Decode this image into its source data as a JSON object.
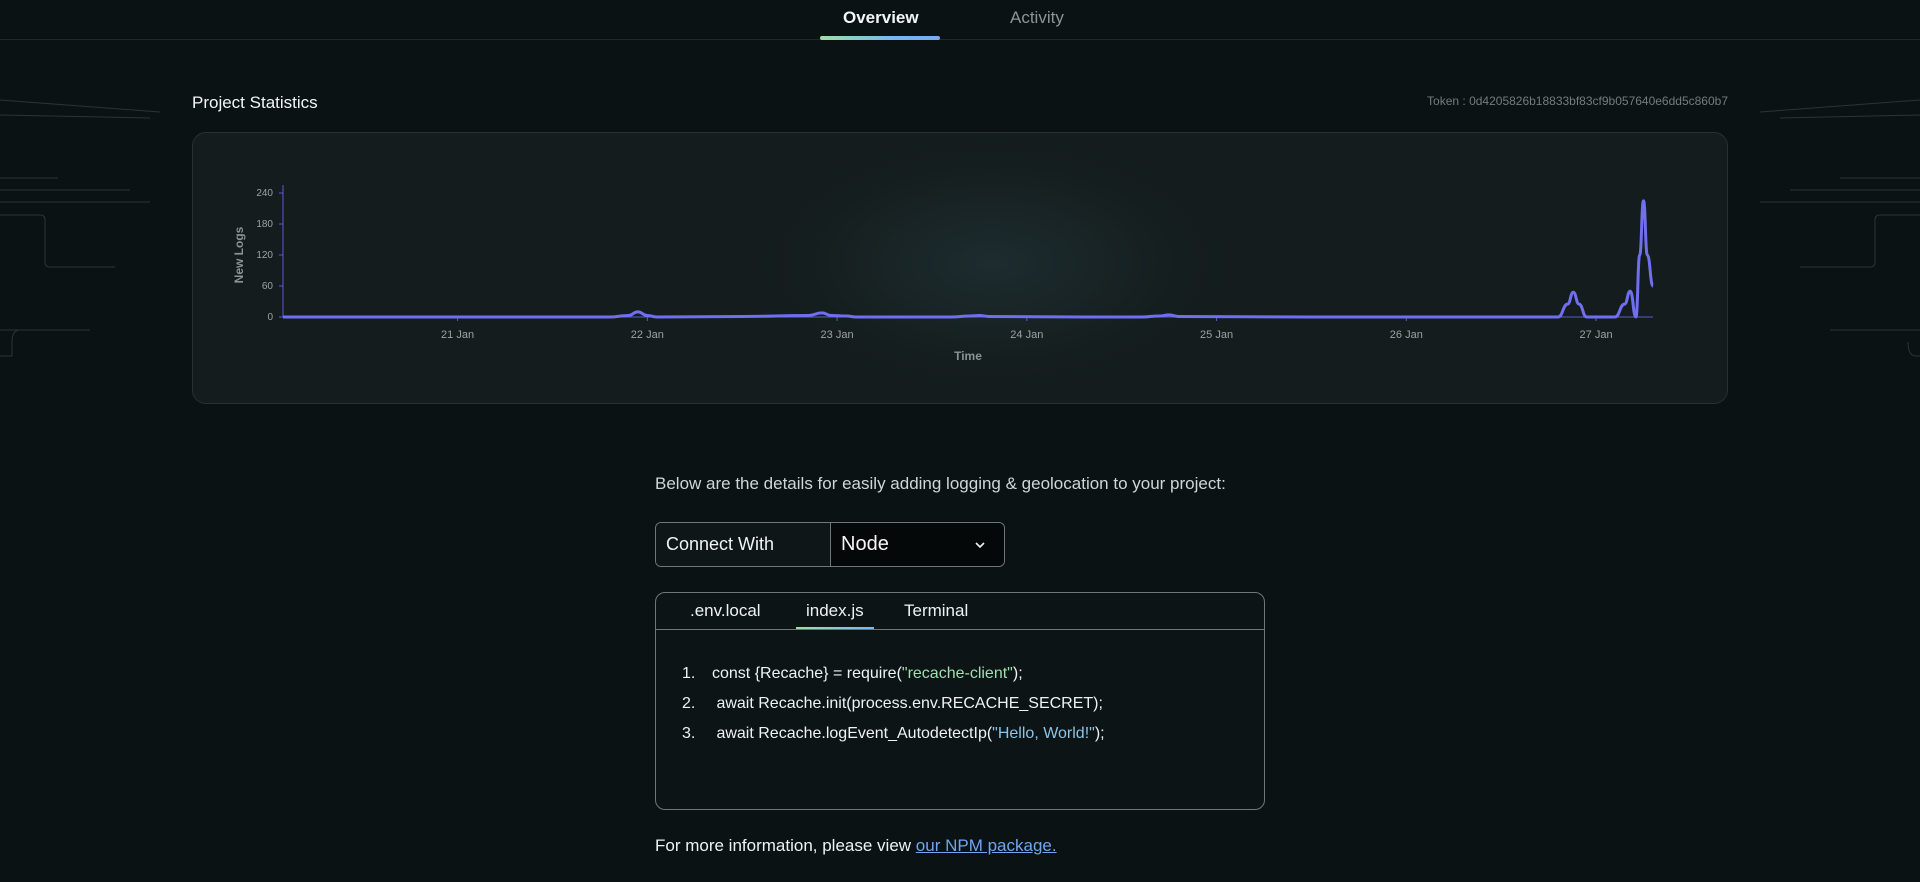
{
  "tabs": [
    {
      "label": "Overview",
      "active": true
    },
    {
      "label": "Activity",
      "active": false
    }
  ],
  "stats": {
    "title": "Project Statistics",
    "token": "Token : 0d4205826b18833bf83cf9b057640e6dd5c860b7"
  },
  "chart_data": {
    "type": "line",
    "xlabel": "Time",
    "ylabel": "New Logs",
    "ylim": [
      0,
      240
    ],
    "y_ticks": [
      "0",
      "60",
      "120",
      "180",
      "240"
    ],
    "x_ticks": [
      "21 Jan",
      "22 Jan",
      "23 Jan",
      "24 Jan",
      "25 Jan",
      "26 Jan",
      "27 Jan"
    ],
    "x_range_days": [
      20.08,
      27.3
    ],
    "line_color": "#6f6ff0",
    "series": [
      {
        "x": [
          20.08,
          21.0,
          21.8,
          21.9,
          21.95,
          22.0,
          22.05,
          22.5,
          22.85,
          22.92,
          22.97,
          23.05,
          23.1,
          23.6,
          23.7,
          23.75,
          23.8,
          24.3,
          24.6,
          24.7,
          24.75,
          24.8,
          25.5,
          26.5,
          26.8,
          26.85,
          26.88,
          26.91,
          26.95,
          27.1,
          27.15,
          27.18,
          27.21,
          27.23,
          27.25,
          27.27,
          27.3
        ],
        "y": [
          0,
          0,
          0,
          3,
          10,
          3,
          0,
          1,
          3,
          8,
          3,
          2,
          0,
          0,
          2,
          3,
          1,
          0,
          0,
          2,
          4,
          1,
          0,
          0,
          0,
          25,
          48,
          25,
          0,
          0,
          25,
          50,
          0,
          120,
          225,
          120,
          60
        ]
      }
    ]
  },
  "details": {
    "intro": "Below are the details for easily adding logging & geolocation to your project:",
    "connect_label": "Connect With",
    "connect_value": "Node"
  },
  "code": {
    "tabs": [
      ".env.local",
      "index.js",
      "Terminal"
    ],
    "active_tab": "index.js",
    "lines": [
      {
        "num": "1.",
        "pre": "const {Recache} = require(",
        "str": "\"recache-client\"",
        "post": ");"
      },
      {
        "num": "2.",
        "pre": " await Recache.init(process.env.RECACHE_SECRET);",
        "str": "",
        "post": ""
      },
      {
        "num": "3.",
        "pre": " await Recache.logEvent_AutodetectIp(",
        "str": "\"Hello, World!\"",
        "post": ");"
      }
    ]
  },
  "footer": {
    "text": "For more information, please view ",
    "link": "our NPM package."
  }
}
